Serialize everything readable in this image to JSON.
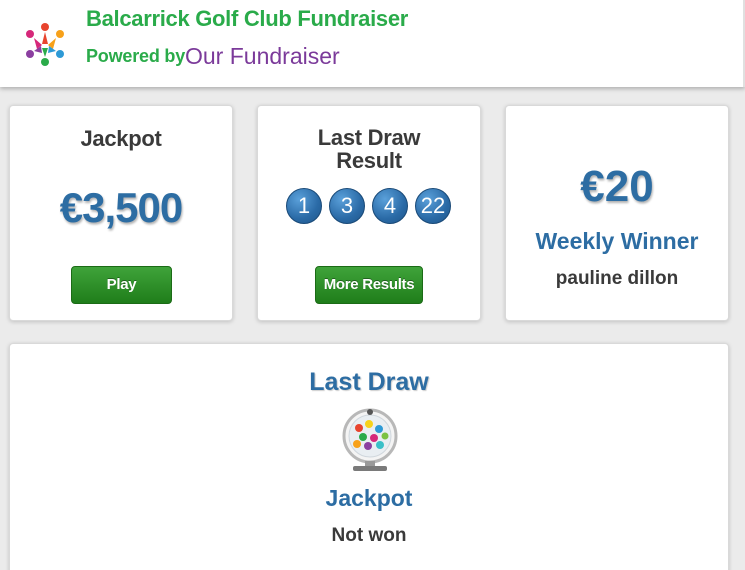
{
  "header": {
    "club_name": "Balcarrick Golf Club Fundraiser",
    "powered_by": "Powered by",
    "brand": "Our Fundraiser"
  },
  "jackpot_card": {
    "title": "Jackpot",
    "amount": "€3,500",
    "button_label": "Play"
  },
  "last_draw_result_card": {
    "title_line1": "Last Draw",
    "title_line2": "Result",
    "balls": [
      "1",
      "3",
      "4",
      "22"
    ],
    "button_label": "More Results"
  },
  "weekly_card": {
    "amount": "€20",
    "label": "Weekly Winner",
    "winner": "pauline dillon"
  },
  "last_draw_card": {
    "title": "Last Draw",
    "jackpot_label": "Jackpot",
    "status": "Not won"
  },
  "colors": {
    "brand_green": "#2aab4a",
    "brand_purple": "#7b3a9a",
    "accent_blue": "#2d6da3",
    "button_green": "#2a8f25"
  },
  "icons": {
    "logo": "people-circle-logo-icon",
    "lottery": "lottery-drum-icon"
  }
}
